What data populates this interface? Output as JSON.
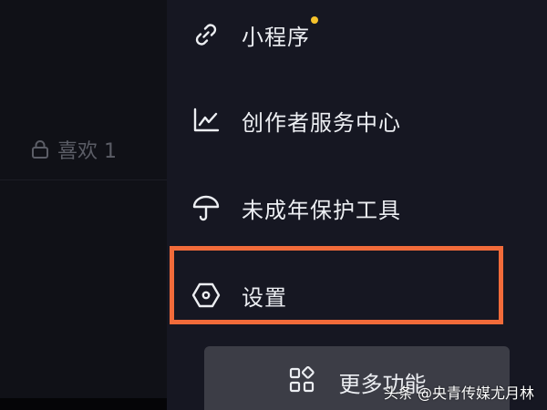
{
  "profile": {
    "likes_tab_label": "喜欢 1"
  },
  "drawer": {
    "items": [
      {
        "label": "小程序",
        "icon": "link-icon",
        "has_badge_dot": true
      },
      {
        "label": "创作者服务中心",
        "icon": "chart-line-icon",
        "has_badge_dot": false
      },
      {
        "label": "未成年保护工具",
        "icon": "umbrella-icon",
        "has_badge_dot": false
      },
      {
        "label": "设置",
        "icon": "hexagon-settings-icon",
        "has_badge_dot": false,
        "highlighted": true
      }
    ],
    "more_button_label": "更多功能",
    "more_button_icon": "grid-apps-icon"
  },
  "colors": {
    "badge_dot": "#f5c22b",
    "highlight_border": "#f26b3a",
    "drawer_bg": "#161722",
    "more_button_bg": "#3c3d46"
  },
  "watermark": "头条 @央青传媒尤月林"
}
